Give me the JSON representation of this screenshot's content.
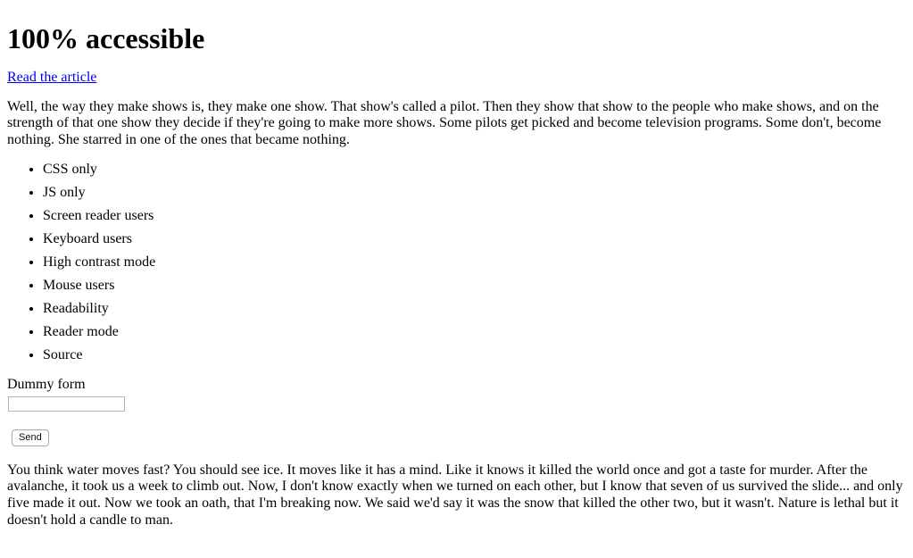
{
  "page": {
    "title": "100% accessible",
    "background_color": "#ffffff",
    "text_color": "#000000",
    "link_color": "#0000ee"
  },
  "article_link": {
    "label": "Read the article"
  },
  "intro_paragraph": "Well, the way they make shows is, they make one show. That show's called a pilot. Then they show that show to the people who make shows, and on the strength of that one show they decide if they're going to make more shows. Some pilots get picked and become television programs. Some don't, become nothing. She starred in one of the ones that became nothing.",
  "feature_list": {
    "items": [
      {
        "label": "CSS only"
      },
      {
        "label": "JS only"
      },
      {
        "label": "Screen reader users"
      },
      {
        "label": "Keyboard users"
      },
      {
        "label": "High contrast mode"
      },
      {
        "label": "Mouse users"
      },
      {
        "label": "Readability"
      },
      {
        "label": "Reader mode"
      },
      {
        "label": "Source"
      }
    ]
  },
  "form": {
    "label": "Dummy form",
    "input_value": "",
    "input_placeholder": "",
    "submit_label": "Send"
  },
  "tail_paragraph": "You think water moves fast? You should see ice. It moves like it has a mind. Like it knows it killed the world once and got a taste for murder. After the avalanche, it took us a week to climb out. Now, I don't know exactly when we turned on each other, but I know that seven of us survived the slide... and only five made it out. Now we took an oath, that I'm breaking now. We said we'd say it was the snow that killed the other two, but it wasn't. Nature is lethal but it doesn't hold a candle to man."
}
